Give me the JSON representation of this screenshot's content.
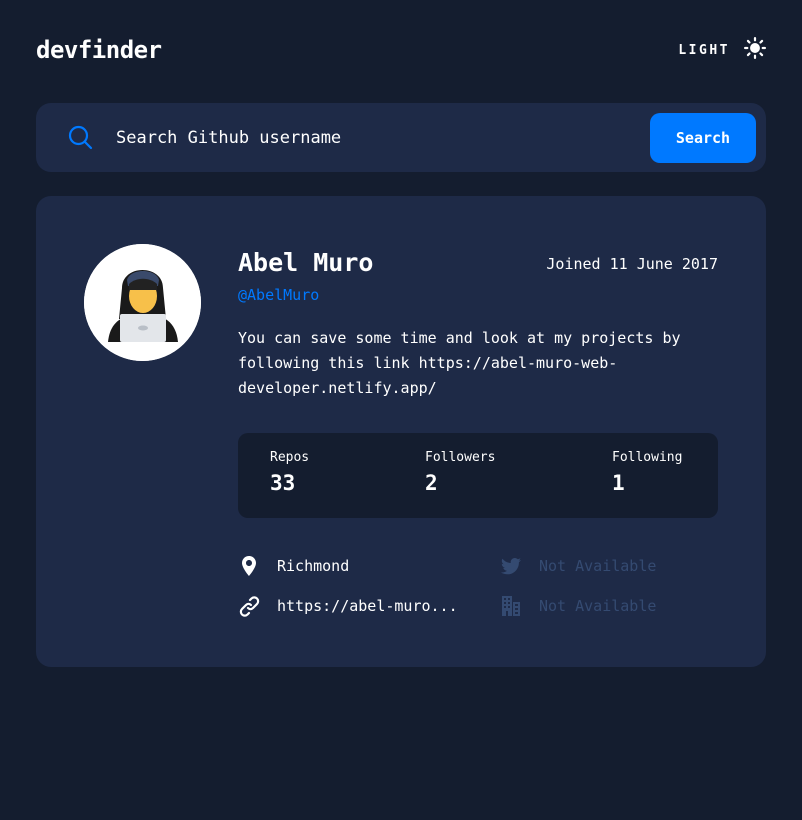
{
  "header": {
    "logo": "devfinder",
    "theme_label": "LIGHT"
  },
  "search": {
    "placeholder": "Search Github username",
    "button_label": "Search"
  },
  "profile": {
    "name": "Abel Muro",
    "login": "@AbelMuro",
    "joined": "Joined 11 June 2017",
    "bio": "You can save some time and look at my projects by following this link https://abel-muro-web-developer.netlify.app/"
  },
  "stats": [
    {
      "label": "Repos",
      "value": "33"
    },
    {
      "label": "Followers",
      "value": "2"
    },
    {
      "label": "Following",
      "value": "1"
    }
  ],
  "links": {
    "location": "Richmond",
    "blog": "https://abel-muro...",
    "twitter": "Not Available",
    "company": "Not Available"
  },
  "colors": {
    "background": "#141D2F",
    "card": "#1E2A47",
    "accent": "#0079FF",
    "muted": "#4B6A9B"
  },
  "icons": {
    "search": "search-icon",
    "theme": "sun-icon",
    "location": "map-pin-icon",
    "blog": "link-icon",
    "twitter": "twitter-icon",
    "company": "building-icon"
  }
}
